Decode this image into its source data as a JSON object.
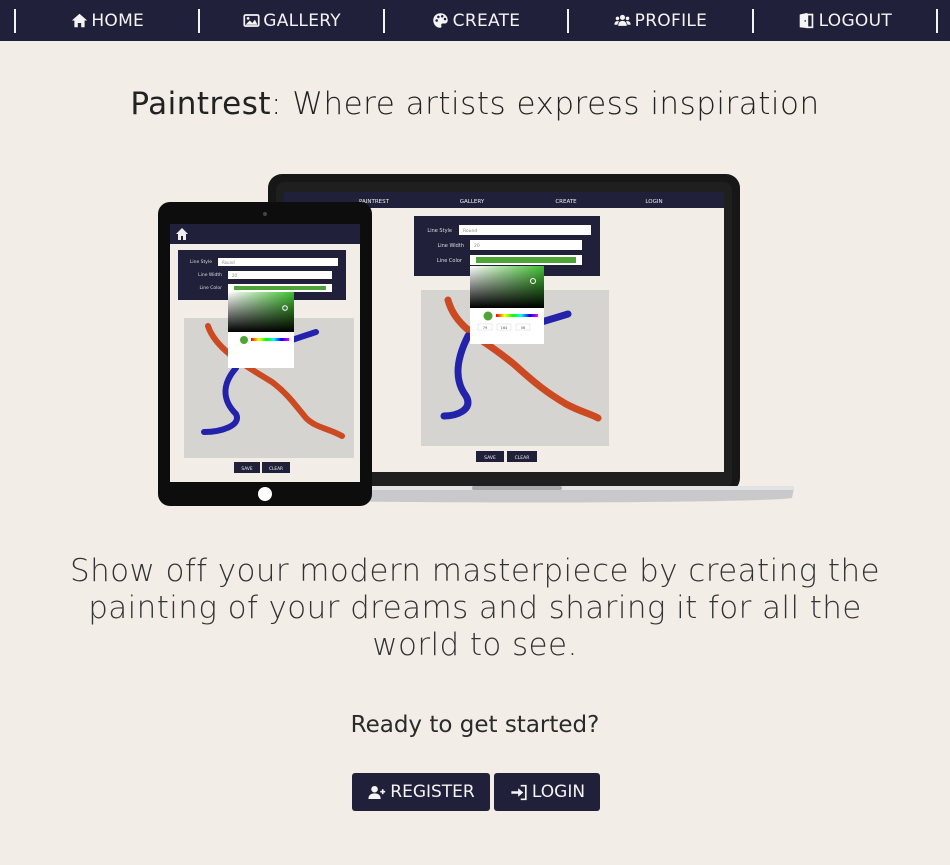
{
  "nav": {
    "items": [
      {
        "label": "HOME",
        "icon": "home-icon"
      },
      {
        "label": "GALLERY",
        "icon": "image-icon"
      },
      {
        "label": "CREATE",
        "icon": "palette-icon"
      },
      {
        "label": "PROFILE",
        "icon": "users-icon"
      },
      {
        "label": "LOGOUT",
        "icon": "door-icon"
      }
    ]
  },
  "hero": {
    "brand": "Paintrest",
    "headline_rest": ": Where artists express inspiration",
    "tagline": "Show off your modern masterpiece by creating the painting of your dreams and sharing it for all the world to see.",
    "ready": "Ready to get started?"
  },
  "actions": {
    "register_label": "REGISTER",
    "login_label": "LOGIN"
  },
  "mockup": {
    "laptop_nav": [
      "PAINTREST",
      "GALLERY",
      "CREATE",
      "LOGIN"
    ],
    "line_style_label": "Line Style",
    "line_style_value": "Round",
    "line_width_label": "Line Width",
    "line_width_value": "20",
    "line_color_label": "Line Color",
    "rgb_values": [
      "79",
      "164",
      "56"
    ],
    "save_label": "SAVE",
    "clear_label": "CLEAR"
  },
  "colors": {
    "nav_bg": "#21203a",
    "page_bg": "#f3ede8",
    "stroke_red": "#cc4a22",
    "stroke_blue": "#2222aa",
    "picker_green": "#4fa438"
  }
}
